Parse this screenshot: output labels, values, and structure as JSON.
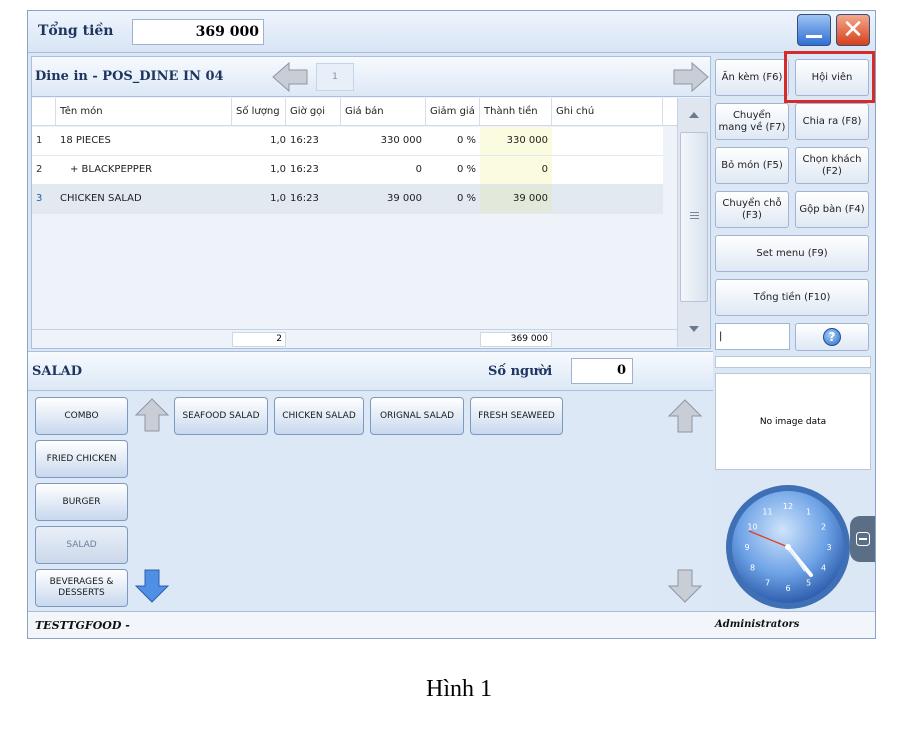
{
  "topbar": {
    "total_label": "Tổng tiền",
    "total_value": "369 000"
  },
  "order": {
    "title": "Dine in - POS_DINE IN 04",
    "page": "1",
    "columns": [
      "Tên món",
      "Số lượng",
      "Giờ gọi",
      "Giá bán",
      "Giảm giá",
      "Thành tiền",
      "Ghi chú"
    ],
    "rows": [
      {
        "no": "1",
        "name": "18 PIECES",
        "qty": "1,0",
        "time": "16:23",
        "price": "330 000",
        "discount": "0 %",
        "amount": "330 000",
        "note": ""
      },
      {
        "no": "2",
        "name": "+ BLACKPEPPER",
        "qty": "1,0",
        "time": "16:23",
        "price": "0",
        "discount": "0 %",
        "amount": "0",
        "note": ""
      },
      {
        "no": "3",
        "name": "CHICKEN SALAD",
        "qty": "1,0",
        "time": "16:23",
        "price": "39 000",
        "discount": "0 %",
        "amount": "39 000",
        "note": ""
      }
    ],
    "footer_qty": "2",
    "footer_total": "369 000"
  },
  "actions": {
    "an_kem": "Ăn kèm (F6)",
    "hoi_vien": "Hội viên",
    "chuyen_mang_ve": "Chuyển mang về (F7)",
    "chia_ra": "Chia ra (F8)",
    "bo_mon": "Bỏ món (F5)",
    "chon_khach": "Chọn khách (F2)",
    "chuyen_cho": "Chuyển chỗ (F3)",
    "gop_ban": "Gộp bàn (F4)",
    "set_menu": "Set menu (F9)",
    "tong_tien": "Tổng tiền (F10)",
    "search_value": "|",
    "help": "?"
  },
  "image_panel": {
    "text": "No image data"
  },
  "category": {
    "title": "SALAD",
    "guest_label": "Số người",
    "guest_value": "0",
    "groups": [
      "COMBO",
      "FRIED CHICKEN",
      "BURGER",
      "SALAD",
      "BEVERAGES & DESSERTS"
    ],
    "items": [
      "SEAFOOD SALAD",
      "CHICKEN SALAD",
      "ORIGNAL SALAD",
      "FRESH SEAWEED"
    ]
  },
  "status": {
    "company": "TESTTGFOOD -",
    "user": "Administrators"
  },
  "clock": {
    "numbers": [
      "12",
      "1",
      "2",
      "3",
      "4",
      "5",
      "6",
      "7",
      "8",
      "9",
      "10",
      "11"
    ]
  },
  "caption": "Hình 1",
  "colors": {
    "highlight": "#d62b2b",
    "accent": "#2a6fcc"
  }
}
